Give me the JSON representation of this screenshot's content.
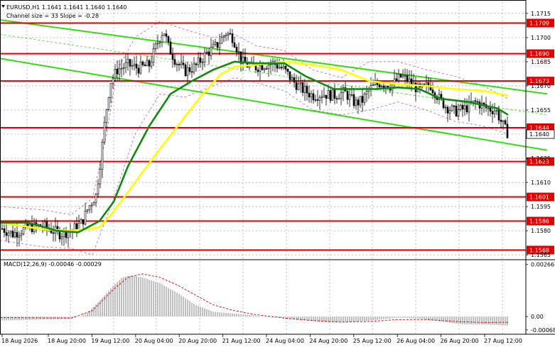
{
  "header": {
    "symbol_line": "EURUSD,H1  1.1641 1.1641 1.1640 1.1640",
    "channel_line": "Channel size = 33 Slope = -0.28"
  },
  "macd_header": "MACD(12,26,9) -0.00046 -0.00029",
  "colors": {
    "level_line": "#e00000",
    "channel": "#33dd11",
    "ma_fast": "#ffff00",
    "ma_slow": "#118811",
    "envelope": "#b060b0",
    "candle": "#000000",
    "histogram": "#c0c0c0",
    "signal": "#dd0000",
    "grid": "#a0a0a0"
  },
  "chart_data": [
    {
      "type": "candlestick",
      "title": "EURUSD,H1",
      "grid": true,
      "ylim": [
        1.1562,
        1.1722
      ],
      "y_ticks": [
        "1.1715",
        "1.1700",
        "1.1685",
        "1.1670",
        "1.1655",
        "1.1640",
        "1.1625",
        "1.1610",
        "1.1595",
        "1.1580",
        "1.1565"
      ],
      "x_labels": [
        "18 Aug 2026",
        "18 Aug 20:00",
        "19 Aug 12:00",
        "20 Aug 04:00",
        "20 Aug 20:00",
        "21 Aug 12:00",
        "24 Aug 04:00",
        "24 Aug 20:00",
        "25 Aug 12:00",
        "26 Aug 04:00",
        "26 Aug 20:00",
        "27 Aug 12:00"
      ],
      "levels": [
        {
          "label": "1.1709",
          "value": 1.1709
        },
        {
          "label": "1.1690",
          "value": 1.169
        },
        {
          "label": "1.1673",
          "value": 1.1673
        },
        {
          "label": "1.1644",
          "value": 1.1644
        },
        {
          "label": "1.1623",
          "value": 1.1623
        },
        {
          "label": "1.1601",
          "value": 1.1601
        },
        {
          "label": "1.1586",
          "value": 1.1586
        },
        {
          "label": "1.1568",
          "value": 1.1568
        }
      ],
      "current_price": {
        "label": "1.1640",
        "value": 1.164
      },
      "channel": {
        "upper": [
          [
            0,
            1.1711
          ],
          [
            770,
            1.1665
          ]
        ],
        "lower": [
          [
            0,
            1.1687
          ],
          [
            770,
            1.163
          ]
        ],
        "dotted": [
          [
            0,
            1.1702
          ],
          [
            770,
            1.1652
          ]
        ]
      },
      "close_path": [
        [
          0,
          1.1582
        ],
        [
          18,
          1.1578
        ],
        [
          40,
          1.1582
        ],
        [
          60,
          1.1583
        ],
        [
          85,
          1.1578
        ],
        [
          100,
          1.158
        ],
        [
          115,
          1.1585
        ],
        [
          125,
          1.1595
        ],
        [
          135,
          1.1602
        ],
        [
          142,
          1.1625
        ],
        [
          148,
          1.165
        ],
        [
          155,
          1.1672
        ],
        [
          165,
          1.168
        ],
        [
          180,
          1.1683
        ],
        [
          195,
          1.1681
        ],
        [
          210,
          1.1683
        ],
        [
          220,
          1.1695
        ],
        [
          230,
          1.1705
        ],
        [
          238,
          1.1693
        ],
        [
          248,
          1.1685
        ],
        [
          260,
          1.1679
        ],
        [
          275,
          1.1682
        ],
        [
          290,
          1.169
        ],
        [
          305,
          1.1695
        ],
        [
          318,
          1.1703
        ],
        [
          328,
          1.17
        ],
        [
          340,
          1.1685
        ],
        [
          355,
          1.1681
        ],
        [
          370,
          1.1683
        ],
        [
          385,
          1.1684
        ],
        [
          400,
          1.168
        ],
        [
          412,
          1.1673
        ],
        [
          425,
          1.1668
        ],
        [
          440,
          1.1664
        ],
        [
          455,
          1.1665
        ],
        [
          470,
          1.1664
        ],
        [
          485,
          1.1666
        ],
        [
          500,
          1.1659
        ],
        [
          510,
          1.1661
        ],
        [
          520,
          1.1668
        ],
        [
          535,
          1.1672
        ],
        [
          550,
          1.167
        ],
        [
          565,
          1.1676
        ],
        [
          578,
          1.1672
        ],
        [
          590,
          1.1667
        ],
        [
          605,
          1.1671
        ],
        [
          618,
          1.1662
        ],
        [
          628,
          1.1657
        ],
        [
          640,
          1.1654
        ],
        [
          655,
          1.1656
        ],
        [
          670,
          1.166
        ],
        [
          685,
          1.1656
        ],
        [
          698,
          1.1655
        ],
        [
          705,
          1.1648
        ],
        [
          712,
          1.1642
        ],
        [
          716,
          1.164
        ]
      ],
      "ma_fast": [
        [
          0,
          1.1585
        ],
        [
          60,
          1.1581
        ],
        [
          100,
          1.158
        ],
        [
          140,
          1.1582
        ],
        [
          160,
          1.1592
        ],
        [
          190,
          1.161
        ],
        [
          220,
          1.1628
        ],
        [
          250,
          1.1645
        ],
        [
          280,
          1.1662
        ],
        [
          310,
          1.1677
        ],
        [
          330,
          1.1682
        ],
        [
          360,
          1.1683
        ],
        [
          400,
          1.1685
        ],
        [
          440,
          1.1683
        ],
        [
          480,
          1.168
        ],
        [
          520,
          1.1673
        ],
        [
          560,
          1.1671
        ],
        [
          600,
          1.167
        ],
        [
          640,
          1.1668
        ],
        [
          680,
          1.1667
        ],
        [
          715,
          1.1664
        ]
      ],
      "ma_slow": [
        [
          0,
          1.1585
        ],
        [
          40,
          1.1585
        ],
        [
          80,
          1.158
        ],
        [
          110,
          1.1579
        ],
        [
          140,
          1.1586
        ],
        [
          160,
          1.1598
        ],
        [
          180,
          1.162
        ],
        [
          210,
          1.1645
        ],
        [
          240,
          1.1665
        ],
        [
          270,
          1.1673
        ],
        [
          300,
          1.168
        ],
        [
          330,
          1.1685
        ],
        [
          360,
          1.1684
        ],
        [
          400,
          1.1684
        ],
        [
          430,
          1.1676
        ],
        [
          470,
          1.1668
        ],
        [
          500,
          1.1668
        ],
        [
          530,
          1.1668
        ],
        [
          560,
          1.1669
        ],
        [
          590,
          1.1668
        ],
        [
          620,
          1.1662
        ],
        [
          660,
          1.166
        ],
        [
          700,
          1.1656
        ],
        [
          715,
          1.1652
        ]
      ],
      "envelope": [
        [
          [
            0,
            1.1595
          ],
          [
            60,
            1.1593
          ],
          [
            100,
            1.159
          ],
          [
            130,
            1.16
          ],
          [
            150,
            1.164
          ],
          [
            165,
            1.168
          ],
          [
            190,
            1.17
          ],
          [
            225,
            1.171
          ],
          [
            260,
            1.1705
          ],
          [
            300,
            1.17
          ],
          [
            330,
            1.1702
          ],
          [
            360,
            1.1695
          ],
          [
            400,
            1.1692
          ],
          [
            440,
            1.168
          ],
          [
            480,
            1.1675
          ],
          [
            520,
            1.1685
          ],
          [
            560,
            1.1685
          ],
          [
            600,
            1.168
          ],
          [
            640,
            1.1676
          ],
          [
            680,
            1.167
          ],
          [
            715,
            1.1662
          ]
        ],
        [
          [
            0,
            1.1574
          ],
          [
            60,
            1.157
          ],
          [
            100,
            1.1569
          ],
          [
            130,
            1.1565
          ],
          [
            160,
            1.16
          ],
          [
            190,
            1.164
          ],
          [
            225,
            1.1665
          ],
          [
            260,
            1.1663
          ],
          [
            300,
            1.167
          ],
          [
            330,
            1.1675
          ],
          [
            360,
            1.1672
          ],
          [
            400,
            1.1667
          ],
          [
            440,
            1.1655
          ],
          [
            480,
            1.1652
          ],
          [
            520,
            1.1655
          ],
          [
            560,
            1.166
          ],
          [
            600,
            1.1655
          ],
          [
            640,
            1.1648
          ],
          [
            680,
            1.1645
          ],
          [
            715,
            1.164
          ]
        ]
      ]
    },
    {
      "type": "histogram",
      "title": "MACD(12,26,9)",
      "ylim": [
        -0.0009,
        0.0029
      ],
      "y_ticks": [
        "0.00266",
        "0.00",
        "-0.00068"
      ],
      "histogram_profile": [
        [
          0,
          -0.0002
        ],
        [
          60,
          -0.00015
        ],
        [
          100,
          -0.0001
        ],
        [
          120,
          0.0001
        ],
        [
          140,
          0.0008
        ],
        [
          160,
          0.0016
        ],
        [
          172,
          0.002
        ],
        [
          185,
          0.0021
        ],
        [
          200,
          0.002
        ],
        [
          225,
          0.0017
        ],
        [
          250,
          0.0012
        ],
        [
          275,
          0.0006
        ],
        [
          300,
          0.00025
        ],
        [
          330,
          0.00015
        ],
        [
          360,
          5e-05
        ],
        [
          390,
          -5e-05
        ],
        [
          430,
          -0.0002
        ],
        [
          460,
          -0.0003
        ],
        [
          490,
          -0.0003
        ],
        [
          520,
          -0.0002
        ],
        [
          560,
          -5e-05
        ],
        [
          590,
          -0.0001
        ],
        [
          620,
          -0.00025
        ],
        [
          650,
          -0.0004
        ],
        [
          680,
          -0.0004
        ],
        [
          715,
          -0.00046
        ]
      ],
      "signal_line": [
        [
          0,
          -5e-05
        ],
        [
          100,
          -8e-05
        ],
        [
          130,
          0.0003
        ],
        [
          160,
          0.0014
        ],
        [
          180,
          0.002
        ],
        [
          200,
          0.00218
        ],
        [
          225,
          0.002
        ],
        [
          250,
          0.0016
        ],
        [
          275,
          0.0011
        ],
        [
          300,
          0.0006
        ],
        [
          330,
          0.0003
        ],
        [
          360,
          0.0001
        ],
        [
          400,
          -8e-05
        ],
        [
          440,
          -0.0002
        ],
        [
          480,
          -0.00028
        ],
        [
          520,
          -0.00025
        ],
        [
          560,
          -0.00015
        ],
        [
          600,
          -0.00015
        ],
        [
          640,
          -0.00025
        ],
        [
          680,
          -0.0003
        ],
        [
          715,
          -0.00029
        ]
      ]
    }
  ]
}
